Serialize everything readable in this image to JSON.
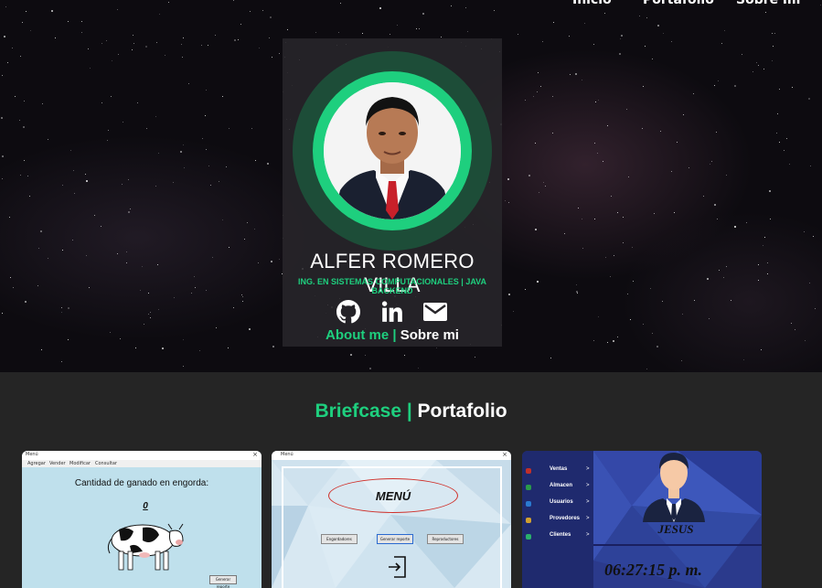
{
  "nav": {
    "items": [
      "Inicio",
      "Portafolio",
      "Sobre mi"
    ]
  },
  "profile": {
    "name": "ALFER ROMERO VILLA",
    "subtitle": "ING. EN SISTEMAS COMPUTACIONALES | JAVA BACKEND",
    "about_en": "About me",
    "about_sep": " | ",
    "about_es": "Sobre mi",
    "social_icons": [
      "github-icon",
      "linkedin-icon",
      "mail-icon"
    ]
  },
  "portfolio": {
    "title_en": "Briefcase",
    "title_sep": " | ",
    "title_es": "Portafolio",
    "projects": [
      {
        "window_title": "Menú",
        "menu": [
          "Agregar",
          "Vender",
          "Modificar",
          "Consultar"
        ],
        "heading": "Cantidad de ganado en engorda:",
        "value": "0",
        "button": "Generar reporte"
      },
      {
        "window_title": "Menú",
        "heading": "MENÚ",
        "buttons": [
          "Engordadores",
          "Generar reporte",
          "Reproductores"
        ]
      },
      {
        "sidebar": [
          "Ventas",
          "Almacen",
          "Usuarios",
          "Provedores",
          "Clientes"
        ],
        "arrow": ">",
        "user": "JESUS",
        "clock": "06:27:15 p. m."
      }
    ]
  },
  "colors": {
    "accent": "#1ecf7e",
    "hero_bg": "#0d0b10",
    "section_bg": "#252525",
    "card_bg": "#28262a"
  }
}
